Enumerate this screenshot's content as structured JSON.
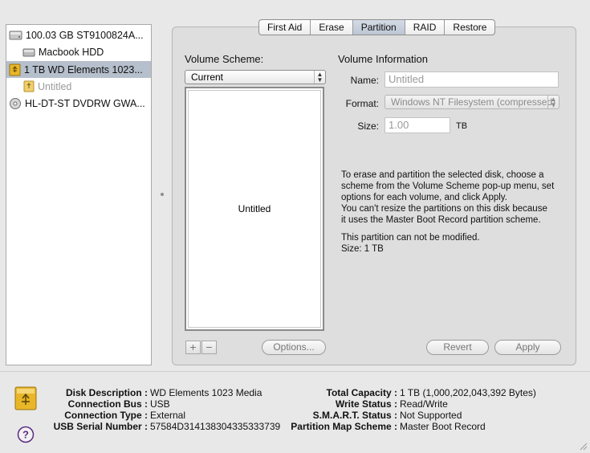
{
  "sidebar": {
    "items": [
      {
        "label": "100.03 GB ST9100824A...",
        "icon": "internal-disk-icon"
      },
      {
        "label": "Macbook HDD",
        "icon": "volume-icon"
      },
      {
        "label": "1 TB WD Elements 1023...",
        "icon": "external-usb-disk-icon",
        "selected": true
      },
      {
        "label": "Untitled",
        "icon": "external-volume-icon",
        "dimmed": true
      },
      {
        "label": "HL-DT-ST DVDRW GWA...",
        "icon": "optical-drive-icon"
      }
    ]
  },
  "tabs": [
    {
      "label": "First Aid"
    },
    {
      "label": "Erase"
    },
    {
      "label": "Partition",
      "active": true
    },
    {
      "label": "RAID"
    },
    {
      "label": "Restore"
    }
  ],
  "volume_scheme": {
    "header": "Volume Scheme:",
    "selected": "Current",
    "volume_label": "Untitled"
  },
  "volume_info": {
    "header": "Volume Information",
    "name_label": "Name:",
    "name_value": "Untitled",
    "format_label": "Format:",
    "format_value": "Windows NT Filesystem (compressed)",
    "size_label": "Size:",
    "size_value": "1.00",
    "size_unit": "TB"
  },
  "instructions": {
    "line1": "To erase and partition the selected disk, choose a",
    "line2": "scheme from the Volume Scheme pop-up menu, set",
    "line3": "options for each volume, and click Apply.",
    "line4": "You can't resize the partitions on this disk because",
    "line5": "it uses the Master Boot Record partition scheme.",
    "status1": "This partition can not be modified.",
    "status2": "Size: 1 TB"
  },
  "buttons": {
    "add": "+",
    "remove": "−",
    "options": "Options...",
    "revert": "Revert",
    "apply": "Apply"
  },
  "disk_info": {
    "description_key": "Disk Description :",
    "description_val": "WD Elements 1023 Media",
    "bus_key": "Connection Bus :",
    "bus_val": "USB",
    "type_key": "Connection Type :",
    "type_val": "External",
    "serial_key": "USB Serial Number :",
    "serial_val": "57584D314138304335333739",
    "capacity_key": "Total Capacity :",
    "capacity_val": "1 TB (1,000,202,043,392 Bytes)",
    "write_key": "Write Status :",
    "write_val": "Read/Write",
    "smart_key": "S.M.A.R.T. Status :",
    "smart_val": "Not Supported",
    "map_key": "Partition Map Scheme :",
    "map_val": "Master Boot Record"
  },
  "colors": {
    "selection": "#b6bfcc",
    "usb_disk": "#e8b627",
    "help_icon": "#5b2c83"
  }
}
